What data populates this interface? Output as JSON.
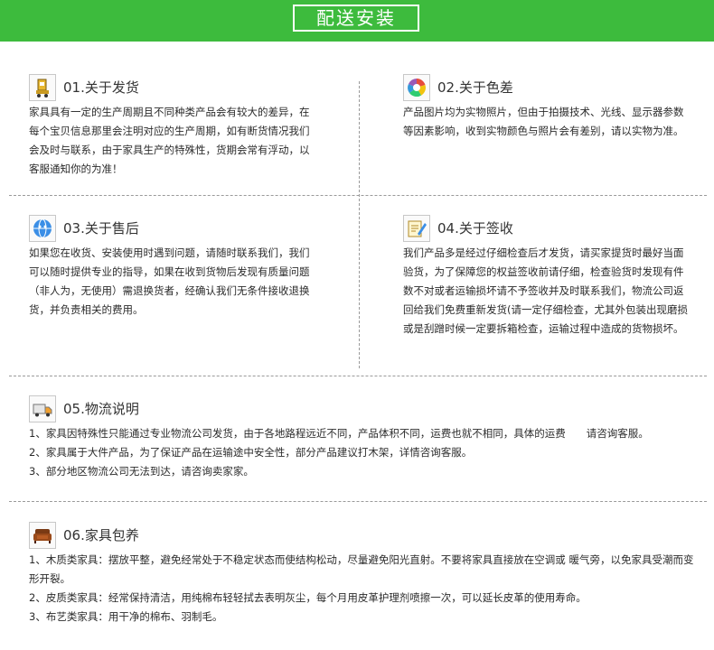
{
  "banner": {
    "title": "配送安装"
  },
  "colors": {
    "banner_bg": "#3dbb3d",
    "divider": "#9a9a9a",
    "text": "#2b2b2b"
  },
  "sections": {
    "delivery": {
      "icon": "forklift-icon",
      "title": "01.关于发货",
      "text": "家具具有一定的生产周期且不同种类产品会有较大的差异，在每个宝贝信息那里会注明对应的生产周期，如有断货情况我们会及时与联系，由于家具生产的特殊性，货期会常有浮动，以客服通知你的为准！"
    },
    "color_diff": {
      "icon": "color-wheel-icon",
      "title": "02.关于色差",
      "text": "产品图片均为实物照片，但由于拍摄技术、光线、显示器参数等因素影响，收到实物颜色与照片会有差别，请以实物为准。"
    },
    "after_sales": {
      "icon": "support-globe-icon",
      "title": "03.关于售后",
      "text": "如果您在收货、安装使用时遇到问题，请随时联系我们，我们可以随时提供专业的指导，如果在收到货物后发现有质量问题（非人为，无使用）需退换货者，经确认我们无条件接收退换货，并负责相关的费用。"
    },
    "sign": {
      "icon": "sign-pen-icon",
      "title": "04.关于签收",
      "text": "我们产品多是经过仔细检查后才发货，请买家提货时最好当面验货，为了保障您的权益签收前请仔细，检查验货时发现有件数不对或者运输损坏请不予签收并及时联系我们，物流公司返回给我们免费重新发货(请一定仔细检查，尤其外包装出现磨损或是刮蹭时候一定要拆箱检查，运输过程中造成的货物损坏。"
    },
    "logistics": {
      "icon": "truck-icon",
      "title": "05.物流说明",
      "items": [
        "1、家具因特殊性只能通过专业物流公司发货，由于各地路程远近不同，产品体积不同，运费也就不相同，具体的运费　　请咨询客服。",
        "2、家具属于大件产品，为了保证产品在运输途中安全性，部分产品建议打木架，详情咨询客服。",
        "3、部分地区物流公司无法到达，请咨询卖家家。"
      ]
    },
    "maintenance": {
      "icon": "sofa-icon",
      "title": "06.家具包养",
      "items": [
        "1、木质类家具：摆放平整，避免经常处于不稳定状态而使结构松动，尽量避免阳光直射。不要将家具直接放在空调或 暖气旁，以免家具受潮而变形开裂。",
        "2、皮质类家具：经常保持清洁，用纯棉布轻轻拭去表明灰尘，每个月用皮革护理剂喷擦一次，可以延长皮革的使用寿命。",
        "3、布艺类家具：用干净的棉布、羽制毛。"
      ]
    }
  }
}
